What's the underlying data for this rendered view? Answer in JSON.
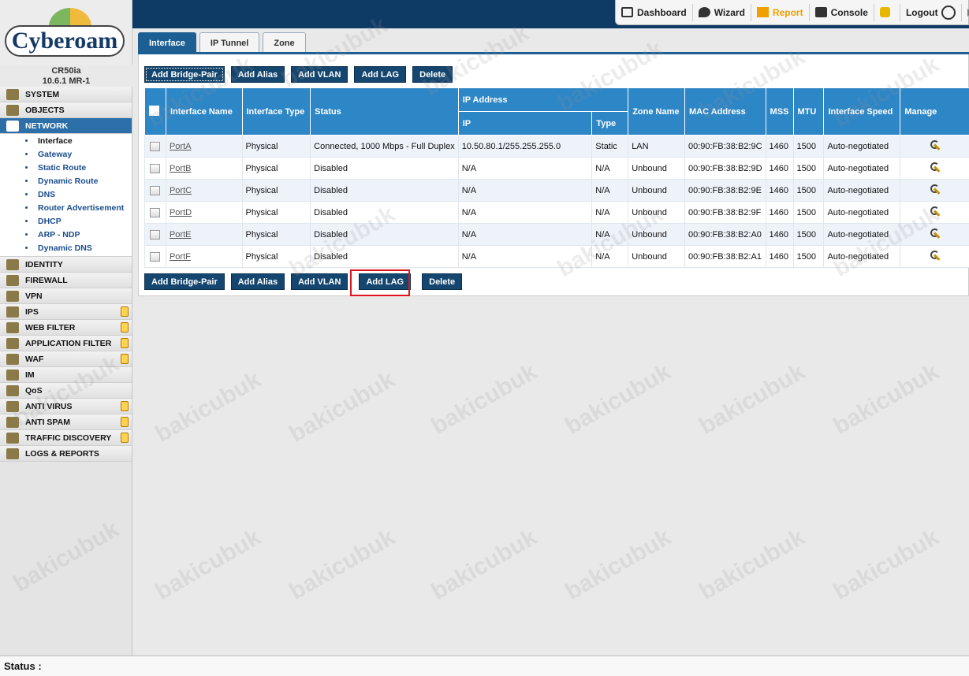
{
  "brand": {
    "logo_text": "Cyberoam",
    "model": "CR50ia",
    "version": "10.6.1 MR-1"
  },
  "toplinks": [
    {
      "label": "Dashboard",
      "icon": "dashboard-icon"
    },
    {
      "label": "Wizard",
      "icon": "wizard-icon"
    },
    {
      "label": "Report",
      "icon": "report-icon",
      "highlight": "#f0a000"
    },
    {
      "label": "Console",
      "icon": "console-icon"
    },
    {
      "label": "Logout",
      "icon": "logout-icon"
    }
  ],
  "sidebar": {
    "sections": [
      {
        "label": "SYSTEM"
      },
      {
        "label": "OBJECTS"
      },
      {
        "label": "NETWORK",
        "active": true
      },
      {
        "label": "IDENTITY"
      },
      {
        "label": "FIREWALL"
      },
      {
        "label": "VPN"
      },
      {
        "label": "IPS",
        "badge": true
      },
      {
        "label": "WEB FILTER",
        "badge": true
      },
      {
        "label": "APPLICATION FILTER",
        "badge": true
      },
      {
        "label": "WAF",
        "badge": true
      },
      {
        "label": "IM"
      },
      {
        "label": "QoS"
      },
      {
        "label": "ANTI VIRUS",
        "badge": true
      },
      {
        "label": "ANTI SPAM",
        "badge": true
      },
      {
        "label": "TRAFFIC DISCOVERY",
        "badge": true
      },
      {
        "label": "LOGS & REPORTS"
      }
    ],
    "network_items": [
      {
        "label": "Interface",
        "active": true
      },
      {
        "label": "Gateway"
      },
      {
        "label": "Static Route"
      },
      {
        "label": "Dynamic Route"
      },
      {
        "label": "DNS"
      },
      {
        "label": "Router Advertisement"
      },
      {
        "label": "DHCP"
      },
      {
        "label": "ARP - NDP"
      },
      {
        "label": "Dynamic DNS"
      }
    ]
  },
  "tabs": [
    {
      "label": "Interface",
      "active": true
    },
    {
      "label": "IP Tunnel"
    },
    {
      "label": "Zone"
    }
  ],
  "buttons": {
    "add_bridge_pair": "Add Bridge-Pair",
    "add_alias": "Add Alias",
    "add_vlan": "Add VLAN",
    "add_lag": "Add LAG",
    "delete": "Delete"
  },
  "table": {
    "headers": {
      "interface_name": "Interface Name",
      "interface_type": "Interface Type",
      "status": "Status",
      "ip_address": "IP Address",
      "ip": "IP",
      "type": "Type",
      "zone_name": "Zone Name",
      "mac_address": "MAC Address",
      "mss": "MSS",
      "mtu": "MTU",
      "interface_speed": "Interface Speed",
      "manage": "Manage"
    },
    "rows": [
      {
        "name": "PortA",
        "itype": "Physical",
        "status": "Connected, 1000 Mbps - Full Duplex",
        "ip": "10.50.80.1/255.255.255.0",
        "iptype": "Static",
        "zone": "LAN",
        "mac": "00:90:FB:38:B2:9C",
        "mss": "1460",
        "mtu": "1500",
        "speed": "Auto-negotiated"
      },
      {
        "name": "PortB",
        "itype": "Physical",
        "status": "Disabled",
        "ip": "N/A",
        "iptype": "N/A",
        "zone": "Unbound",
        "mac": "00:90:FB:38:B2:9D",
        "mss": "1460",
        "mtu": "1500",
        "speed": "Auto-negotiated"
      },
      {
        "name": "PortC",
        "itype": "Physical",
        "status": "Disabled",
        "ip": "N/A",
        "iptype": "N/A",
        "zone": "Unbound",
        "mac": "00:90:FB:38:B2:9E",
        "mss": "1460",
        "mtu": "1500",
        "speed": "Auto-negotiated"
      },
      {
        "name": "PortD",
        "itype": "Physical",
        "status": "Disabled",
        "ip": "N/A",
        "iptype": "N/A",
        "zone": "Unbound",
        "mac": "00:90:FB:38:B2:9F",
        "mss": "1460",
        "mtu": "1500",
        "speed": "Auto-negotiated"
      },
      {
        "name": "PortE",
        "itype": "Physical",
        "status": "Disabled",
        "ip": "N/A",
        "iptype": "N/A",
        "zone": "Unbound",
        "mac": "00:90:FB:38:B2:A0",
        "mss": "1460",
        "mtu": "1500",
        "speed": "Auto-negotiated"
      },
      {
        "name": "PortF",
        "itype": "Physical",
        "status": "Disabled",
        "ip": "N/A",
        "iptype": "N/A",
        "zone": "Unbound",
        "mac": "00:90:FB:38:B2:A1",
        "mss": "1460",
        "mtu": "1500",
        "speed": "Auto-negotiated"
      }
    ]
  },
  "status_bar": {
    "label": "Status :"
  },
  "watermark": "bakicubuk",
  "colors": {
    "header_bg": "#0e3a66",
    "table_header": "#2d86c6",
    "button_bg": "#14466f",
    "highlight_box": "#e0141e"
  }
}
